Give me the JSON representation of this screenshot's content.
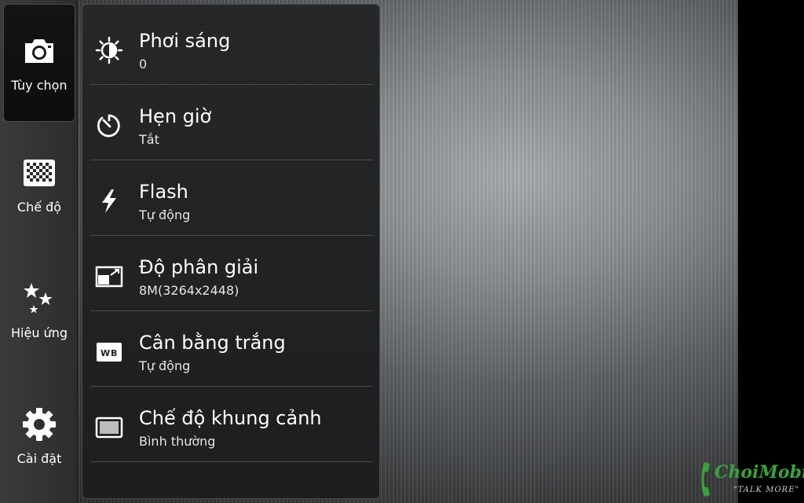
{
  "rail": {
    "items": [
      {
        "label": "Tùy chọn",
        "icon": "camera-icon",
        "active": true
      },
      {
        "label": "Chế độ",
        "icon": "mode-grid-icon",
        "active": false
      },
      {
        "label": "Hiệu ứng",
        "icon": "sparkle-effects-icon",
        "active": false
      },
      {
        "label": "Cài đặt",
        "icon": "gear-icon",
        "active": false
      }
    ]
  },
  "settings": {
    "rows": [
      {
        "title": "Phơi sáng",
        "value": "0",
        "icon": "exposure-icon"
      },
      {
        "title": "Hẹn giờ",
        "value": "Tắt",
        "icon": "timer-icon"
      },
      {
        "title": "Flash",
        "value": "Tự động",
        "icon": "flash-icon"
      },
      {
        "title": "Độ phân giải",
        "value": "8M(3264x2448)",
        "icon": "resolution-icon"
      },
      {
        "title": "Cân bằng trắng",
        "value": "Tự động",
        "icon": "white-balance-icon"
      },
      {
        "title": "Chế độ khung cảnh",
        "value": "Bình thường",
        "icon": "scene-mode-icon"
      }
    ]
  },
  "watermark": {
    "brand": "ChoiMobile",
    "tagline": "\"TALK MORE\""
  },
  "colors": {
    "accent_white": "#ffffff",
    "panel_bg": "#1d1e1f",
    "watermark_green": "#3aa23a"
  }
}
